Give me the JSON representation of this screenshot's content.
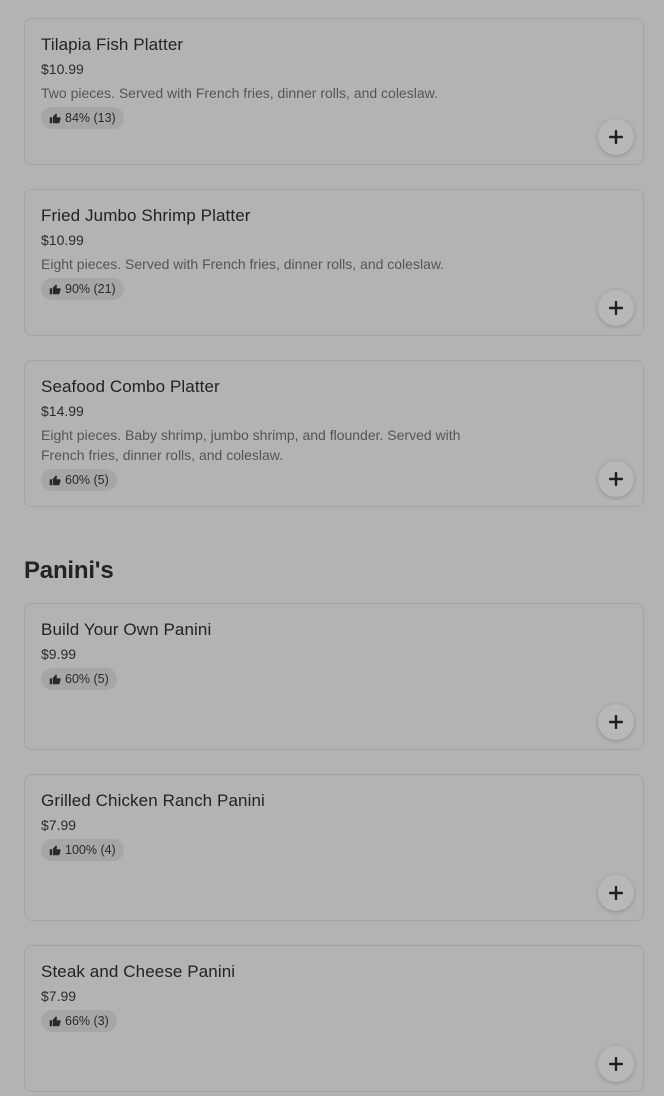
{
  "sections": [
    {
      "items": [
        {
          "name": "Tilapia Fish Platter",
          "price": "$10.99",
          "description": "Two pieces. Served with French fries, dinner rolls, and coleslaw.",
          "rating": "84% (13)"
        },
        {
          "name": "Fried Jumbo Shrimp Platter",
          "price": "$10.99",
          "description": "Eight pieces. Served with French fries, dinner rolls, and coleslaw.",
          "rating": "90% (21)"
        },
        {
          "name": "Seafood Combo Platter",
          "price": "$14.99",
          "description": "Eight pieces. Baby shrimp, jumbo shrimp, and flounder. Served with French fries, dinner rolls, and coleslaw.",
          "rating": "60% (5)"
        }
      ]
    },
    {
      "title": "Panini's",
      "items": [
        {
          "name": "Build Your Own Panini",
          "price": "$9.99",
          "rating": "60% (5)"
        },
        {
          "name": "Grilled Chicken Ranch Panini",
          "price": "$7.99",
          "rating": "100% (4)"
        },
        {
          "name": "Steak and Cheese Panini",
          "price": "$7.99",
          "rating": "66% (3)"
        }
      ]
    }
  ],
  "icons": {
    "rating": "thumbs-up-icon",
    "add": "plus-icon"
  },
  "colors": {
    "overlay_background": "#b3b3b3",
    "text": "#232323"
  }
}
